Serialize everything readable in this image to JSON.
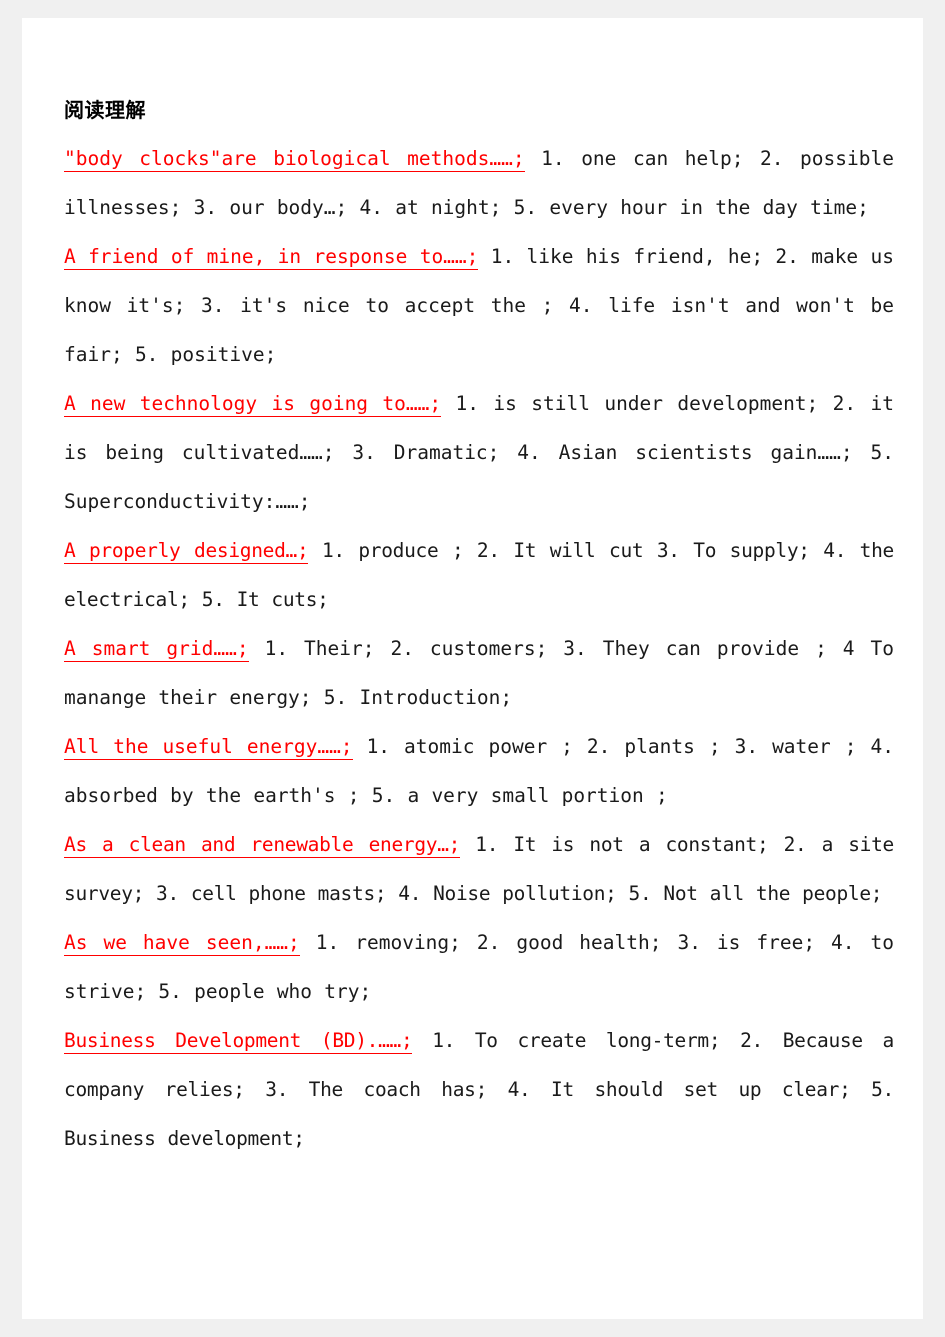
{
  "document": {
    "heading": "阅读理解",
    "entries": [
      {
        "title": "\"body clocks\"are biological methods……;",
        "answers": "1. one can help;  2. possible illnesses;  3. our body…;  4. at night;  5. every hour in the day time;"
      },
      {
        "title": "A friend of mine, in response to……;",
        "answers": "1. like his friend, he;  2. make us know it's;  3. it's nice to accept the ;  4. life isn't and won't be fair;  5. positive;"
      },
      {
        "title": "A new technology is going to……;",
        "answers": "1. is still under development;  2. it is being cultivated……;  3. Dramatic;  4. Asian scientists gain……;  5. Superconductivity:……;"
      },
      {
        "title": "A properly designed…;",
        "answers": "1.   produce ;  2. It will cut 3. To supply;  4.  the electrical;  5. It cuts;"
      },
      {
        "title": "A smart grid……;",
        "answers": "1. Their;  2. customers;  3. They can provide ;  4 To manange  their energy;  5. Introduction;"
      },
      {
        "title": "All the useful energy……;",
        "answers": "1. atomic power  ;  2. plants  ;  3. water ;  4. absorbed by the earth's  ;  5. a very small portion  ;"
      },
      {
        "title": "As a clean and renewable energy…;",
        "answers": "1. It is not a constant;  2. a site survey; 3. cell phone masts; 4. Noise pollution; 5. Not all the people;"
      },
      {
        "title": "As we have seen,……;",
        "answers": "1. removing;  2. good health;  3. is free;  4. to strive;  5. people who try;"
      },
      {
        "title": "Business Development (BD).……;",
        "answers": "1. To create long-term; 2. Because a company relies; 3. The coach has; 4. It should set up clear; 5. Business development;"
      }
    ]
  },
  "colors": {
    "title_red": "#ff0000",
    "body_black": "#1a1a1a",
    "page_background": "#ffffff",
    "canvas_background": "#f0f0f0"
  }
}
